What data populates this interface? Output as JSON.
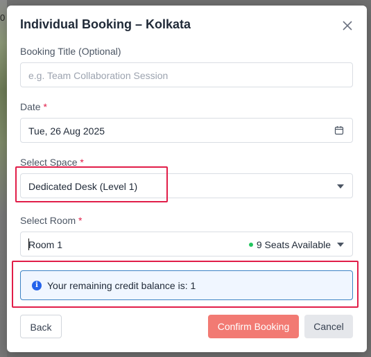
{
  "modal": {
    "title": "Individual Booking – Kolkata",
    "close_icon": "close-icon"
  },
  "background": {
    "edge_text": "0"
  },
  "form": {
    "booking_title": {
      "label": "Booking Title (Optional)",
      "placeholder": "e.g. Team Collaboration Session",
      "value": ""
    },
    "date": {
      "label": "Date",
      "required_mark": "*",
      "value": "Tue, 26 Aug 2025",
      "icon": "calendar-icon"
    },
    "space": {
      "label": "Select Space",
      "required_mark": "*",
      "selected": "Dedicated Desk (Level 1)",
      "icon": "chevron-down-icon"
    },
    "room": {
      "label": "Select Room",
      "required_mark": "*",
      "selected": "Room 1",
      "availability": "9 Seats Available",
      "availability_color": "#22c55e",
      "icon": "chevron-down-icon"
    }
  },
  "info_banner": {
    "icon": "info-icon",
    "text": "Your remaining credit balance is: 1"
  },
  "actions": {
    "back_label": "Back",
    "confirm_label": "Confirm Booking",
    "cancel_label": "Cancel"
  },
  "colors": {
    "highlight": "#e11d48",
    "confirm_button": "#f27a73",
    "info_border": "#3b82c4"
  }
}
